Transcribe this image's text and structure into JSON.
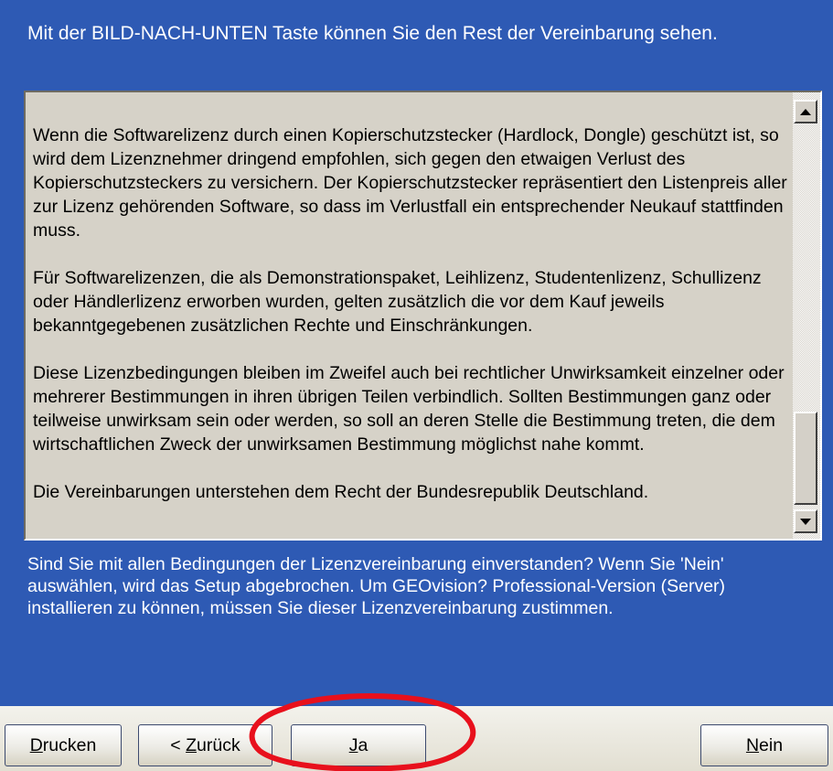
{
  "instruction": "Mit der BILD-NACH-UNTEN Taste können Sie den Rest der Vereinbarung sehen.",
  "license_paragraphs": [
    "Wenn die Softwarelizenz durch einen Kopierschutzstecker (Hardlock, Dongle) geschützt ist, so wird dem Lizenznehmer dringend empfohlen, sich gegen den etwaigen Verlust des Kopierschutzsteckers zu versichern. Der Kopierschutzstecker repräsentiert den Listenpreis aller zur Lizenz gehörenden Software, so dass im Verlustfall ein entsprechender Neukauf stattfinden muss.",
    "Für Softwarelizenzen, die als Demonstrationspaket, Leihlizenz, Studentenlizenz, Schullizenz oder Händlerlizenz erworben wurden, gelten zusätzlich die vor dem Kauf jeweils bekanntgegebenen zusätzlichen Rechte und Einschränkungen.",
    "Diese Lizenzbedingungen bleiben im Zweifel auch bei rechtlicher Unwirksamkeit einzelner oder mehrerer Bestimmungen in ihren übrigen Teilen verbindlich. Sollten Bestimmungen ganz oder teilweise unwirksam sein oder werden, so soll an deren Stelle die Bestimmung treten, die dem wirtschaftlichen Zweck der unwirksamen Bestimmung möglichst nahe kommt.",
    "Die Vereinbarungen unterstehen dem Recht der Bundesrepublik Deutschland."
  ],
  "question": "Sind Sie mit allen Bedingungen der Lizenzvereinbarung einverstanden? Wenn Sie 'Nein' auswählen, wird das Setup abgebrochen.  Um GEOvision? Professional-Version (Server) installieren zu können, müssen Sie dieser Lizenzvereinbarung zustimmen.",
  "buttons": {
    "drucken": {
      "mnemonic": "D",
      "rest": "rucken"
    },
    "zurueck": {
      "prefix": "< ",
      "mnemonic": "Z",
      "rest": "urück"
    },
    "ja": {
      "mnemonic": "J",
      "rest": "a"
    },
    "nein": {
      "mnemonic": "N",
      "rest": "ein"
    }
  },
  "scrollbar": {
    "position_fraction": 0.82
  },
  "colors": {
    "background": "#2e5ab4",
    "text_area": "#d6d2c8",
    "annotation": "#e8101c"
  },
  "icons": [
    "scroll-up-arrow-icon",
    "scroll-down-arrow-icon"
  ]
}
